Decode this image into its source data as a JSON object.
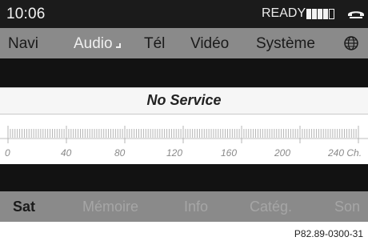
{
  "status": {
    "time": "10:06",
    "ready": "READY",
    "signal_bars_filled": 4,
    "signal_bars_total": 5
  },
  "menu": {
    "items": [
      {
        "label": "Navi"
      },
      {
        "label": "Audio"
      },
      {
        "label": "Tél"
      },
      {
        "label": "Vidéo"
      },
      {
        "label": "Système"
      }
    ],
    "active": "Audio"
  },
  "service": {
    "text": "No Service"
  },
  "scale": {
    "labels": [
      "0",
      "40",
      "80",
      "120",
      "160",
      "200",
      "240 Ch."
    ]
  },
  "softkeys": {
    "items": [
      {
        "label": "Sat"
      },
      {
        "label": "Mémoire"
      },
      {
        "label": "Info"
      },
      {
        "label": "Catég."
      },
      {
        "label": "Son"
      }
    ],
    "active": "Sat"
  },
  "reference": "P82.89-0300-31",
  "colors": {
    "status_bg": "#1b1b1b",
    "menu_bg": "#8a8a8a",
    "active_text": "#efefef",
    "dark_band": "#121212"
  }
}
